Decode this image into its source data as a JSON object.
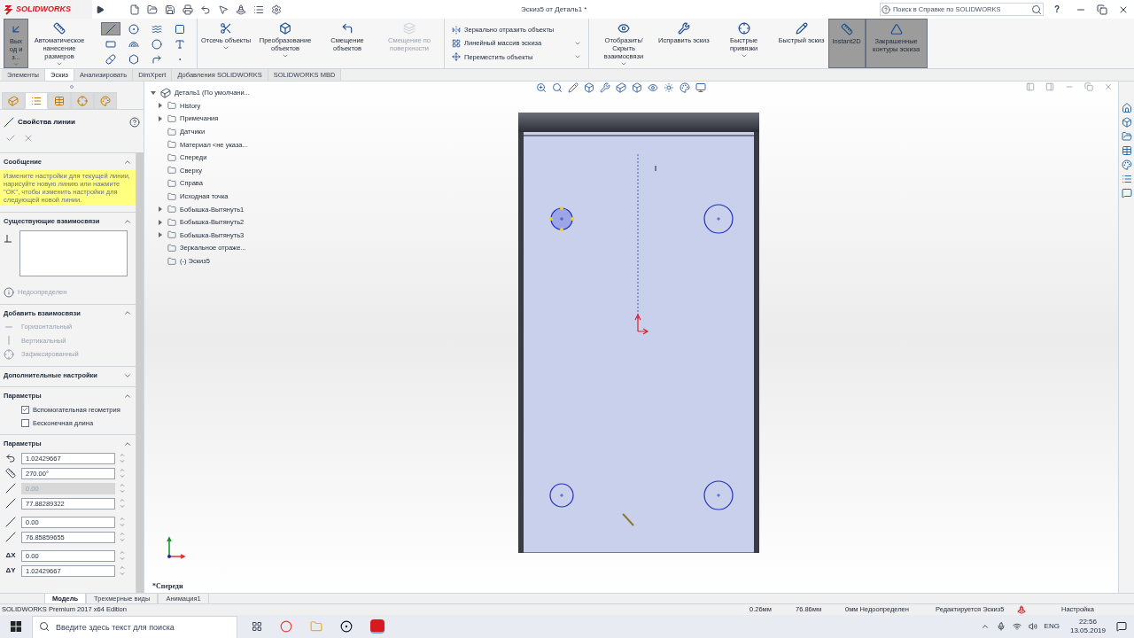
{
  "app": {
    "logo": "SOLIDWORKS",
    "title": "Эскиз5 от Деталь1 *",
    "help_search": {
      "placeholder": "Поиск в Справке по SOLIDWORKS"
    },
    "help": "?"
  },
  "ribbon": [
    {
      "kind": "large",
      "label": "Выход из...",
      "selected": true,
      "disabled": false,
      "has_menu": true
    },
    {
      "kind": "large",
      "label": "Автоматическое нанесение размеров",
      "selected": false,
      "disabled": false,
      "has_menu": true
    },
    {
      "kind": "tools",
      "tools": [
        {
          "selected": true
        },
        {
          "selected": false
        },
        {
          "selected": false
        },
        {
          "selected": false
        },
        {
          "selected": false
        },
        {
          "selected": false
        },
        {
          "selected": false
        },
        {
          "selected": false
        },
        {
          "selected": false
        },
        {
          "selected": false
        },
        {
          "selected": false
        },
        {
          "selected": false
        }
      ]
    },
    {
      "kind": "large",
      "label": "Отсечь объекты",
      "selected": false,
      "disabled": false,
      "has_menu": true
    },
    {
      "kind": "large",
      "label": "Преобразование объектов",
      "selected": false,
      "disabled": false,
      "has_menu": true
    },
    {
      "kind": "large",
      "label": "Смещение объектов",
      "selected": false,
      "disabled": false,
      "has_menu": false
    },
    {
      "kind": "large",
      "label": "Смещение по поверхности",
      "selected": false,
      "disabled": true,
      "has_menu": false
    },
    {
      "kind": "list",
      "items": [
        {
          "label": "Зеркально отразить объекты",
          "has_menu": false
        },
        {
          "label": "Линейный массив эскиза",
          "has_menu": true
        },
        {
          "label": "Переместить объекты",
          "has_menu": true
        }
      ]
    },
    {
      "kind": "large",
      "label": "Отобразить/Скрыть взаимосвязи",
      "selected": false,
      "disabled": false,
      "has_menu": true
    },
    {
      "kind": "large",
      "label": "Исправить эскиз",
      "selected": false,
      "disabled": false,
      "has_menu": false
    },
    {
      "kind": "large",
      "label": "Быстрые привязки",
      "selected": false,
      "disabled": false,
      "has_menu": true
    },
    {
      "kind": "large",
      "label": "Быстрый эскиз",
      "selected": false,
      "disabled": false,
      "has_menu": false
    },
    {
      "kind": "large",
      "label": "Instant2D",
      "selected": true,
      "disabled": false,
      "has_menu": false
    },
    {
      "kind": "large",
      "label": "Закрашенные контуры эскиза",
      "selected": true,
      "disabled": false,
      "has_menu": false
    }
  ],
  "tabs": [
    {
      "label": "Элементы",
      "selected": false
    },
    {
      "label": "Эскиз",
      "selected": true
    },
    {
      "label": "Анализировать",
      "selected": false
    },
    {
      "label": "DimXpert",
      "selected": false
    },
    {
      "label": "Добавления SOLIDWORKS",
      "selected": false
    },
    {
      "label": "SOLIDWORKS MBD",
      "selected": false
    }
  ],
  "property_manager": {
    "tabs": [
      {
        "selected": false
      },
      {
        "selected": true
      },
      {
        "selected": false
      },
      {
        "selected": false
      },
      {
        "selected": false
      }
    ],
    "title": "Свойства линии",
    "sections": [
      {
        "kind": "message",
        "title": "Сообщение",
        "expanded": true,
        "text": "Измените настройки для текущей линии, нарисуйте новую линию или нажмите \"OK\", чтобы изменить настройки для следующей новой линии."
      },
      {
        "kind": "relations",
        "title": "Существующие взаимосвязи",
        "expanded": true,
        "status": "Недоопределен"
      },
      {
        "kind": "add_relations",
        "title": "Добавить взаимосвязи",
        "expanded": true,
        "items": [
          {
            "label": "Горизонтальный",
            "disabled": true
          },
          {
            "label": "Вертикальный",
            "disabled": true
          },
          {
            "label": "Зафиксированный",
            "disabled": true
          }
        ]
      },
      {
        "kind": "more",
        "title": "Дополнительные настройки",
        "expanded": false
      },
      {
        "kind": "options",
        "title": "Параметры",
        "expanded": true,
        "checkboxes": [
          {
            "label": "Вспомогательная геометрия",
            "checked": true
          },
          {
            "label": "Бесконечная длина",
            "checked": false
          }
        ]
      },
      {
        "kind": "parameters",
        "title": "Параметры",
        "expanded": true,
        "fields": [
          {
            "value": "1.02429667",
            "disabled": false
          },
          {
            "value": "270.00°",
            "disabled": false
          },
          {
            "value": "0.00",
            "disabled": true
          },
          {
            "value": "77.88289322",
            "disabled": false
          },
          {
            "value": "0.00",
            "disabled": false
          },
          {
            "value": "76.85859655",
            "disabled": false
          },
          {
            "label": "ΔX",
            "value": "0.00",
            "disabled": false
          },
          {
            "label": "ΔY",
            "value": "1.02429667",
            "disabled": false
          }
        ]
      }
    ]
  },
  "feature_tree": {
    "label": "Деталь1  (По умолчани...",
    "expanded": true,
    "children": [
      {
        "label": "History",
        "kind": "group",
        "expanded": false
      },
      {
        "label": "Примечания",
        "kind": "group",
        "expanded": false
      },
      {
        "label": "Датчики",
        "kind": "item"
      },
      {
        "label": "Материал <не указа...",
        "kind": "item"
      },
      {
        "label": "Спереди",
        "kind": "item"
      },
      {
        "label": "Сверху",
        "kind": "item"
      },
      {
        "label": "Справа",
        "kind": "item"
      },
      {
        "label": "Исходная точка",
        "kind": "item"
      },
      {
        "label": "Бобышка-Вытянуть1",
        "kind": "group",
        "expanded": false
      },
      {
        "label": "Бобышка-Вытянуть2",
        "kind": "group",
        "expanded": false
      },
      {
        "label": "Бобышка-Вытянуть3",
        "kind": "group",
        "expanded": false
      },
      {
        "label": "Зеркальное отраже...",
        "kind": "item"
      },
      {
        "label": "(-) Эскиз5",
        "kind": "item"
      }
    ]
  },
  "holes": [
    {
      "selected": true
    },
    {
      "selected": false
    },
    {
      "selected": false
    },
    {
      "selected": false
    }
  ],
  "view_label": "*Спереди",
  "bottom_tabs": [
    {
      "label": "Модель",
      "selected": true
    },
    {
      "label": "Трехмерные виды",
      "selected": false
    },
    {
      "label": "Анимация1",
      "selected": false
    }
  ],
  "status_bar": {
    "edition": "SOLIDWORKS Premium 2017 x64 Edition",
    "x": "0.26мм",
    "y": "76.86мм",
    "state": "0мм Недоопределен",
    "editing": "Редактируется Эскиз5",
    "units": "Настройка"
  },
  "taskbar": {
    "search": {
      "placeholder": "Введите здесь текст для поиска"
    },
    "language": "ENG",
    "time": "22:56",
    "date": "13.05.2019"
  }
}
